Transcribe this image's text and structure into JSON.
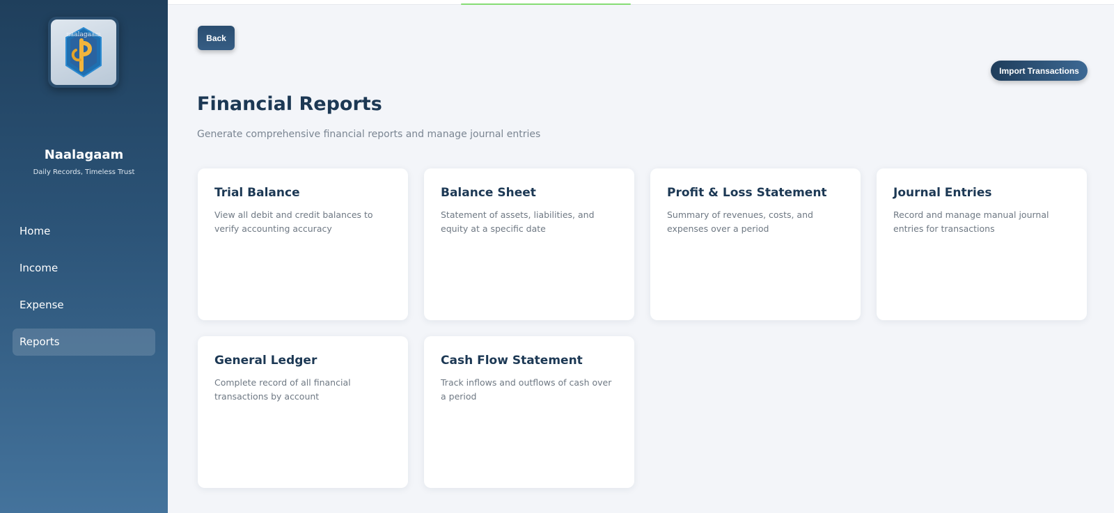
{
  "app": {
    "name": "Naalagaam",
    "tagline": "Daily Records, Timeless Trust",
    "logo_text": "naalagaam"
  },
  "sidebar": {
    "items": [
      {
        "label": "Home",
        "active": false
      },
      {
        "label": "Income",
        "active": false
      },
      {
        "label": "Expense",
        "active": false
      },
      {
        "label": "Reports",
        "active": true
      }
    ]
  },
  "toolbar": {
    "back_label": "Back",
    "import_label": "Import Transactions"
  },
  "main": {
    "title": "Financial Reports",
    "subtitle": "Generate comprehensive financial reports and manage journal entries",
    "cards": [
      {
        "title": "Trial Balance",
        "description": "View all debit and credit balances to verify accounting accuracy"
      },
      {
        "title": "Balance Sheet",
        "description": "Statement of assets, liabilities, and equity at a specific date"
      },
      {
        "title": "Profit & Loss Statement",
        "description": "Summary of revenues, costs, and expenses over a period"
      },
      {
        "title": "Journal Entries",
        "description": "Record and manage manual journal entries for transactions"
      },
      {
        "title": "General Ledger",
        "description": "Complete record of all financial transactions by account"
      },
      {
        "title": "Cash Flow Statement",
        "description": "Track inflows and outflows of cash over a period"
      }
    ]
  },
  "colors": {
    "sidebar_top": "#1f3f5c",
    "sidebar_bottom": "#44739c",
    "heading": "#1c3854",
    "background": "#f3f5f9",
    "accent": "#2a4d70"
  }
}
